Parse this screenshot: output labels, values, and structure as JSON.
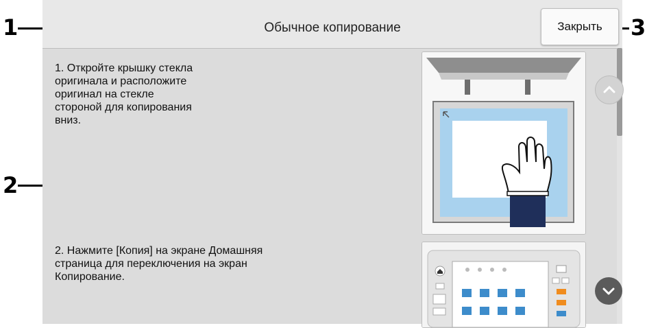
{
  "dialog": {
    "title": "Обычное копирование",
    "close_label": "Закрыть"
  },
  "callouts": [
    "1",
    "2",
    "3"
  ],
  "steps": [
    {
      "text": "1. Откройте крышку стекла\nоригинала и расположите\nоригинал на стекле\nстороной для копирования\nвниз."
    },
    {
      "text": "2. Нажмите [Копия] на экране Домашняя\nстраница для переключения на экран\nКопирование."
    }
  ],
  "icons": {
    "scroll_up": "chevron-up-icon",
    "scroll_down": "chevron-down-icon",
    "hand": "hand-icon",
    "home": "home-icon"
  },
  "colors": {
    "panel_bg": "#dcdcdc",
    "glass_blue": "#a9d2ee",
    "tile_blue": "#3d8ccb",
    "tile_orange": "#f08c1e"
  }
}
